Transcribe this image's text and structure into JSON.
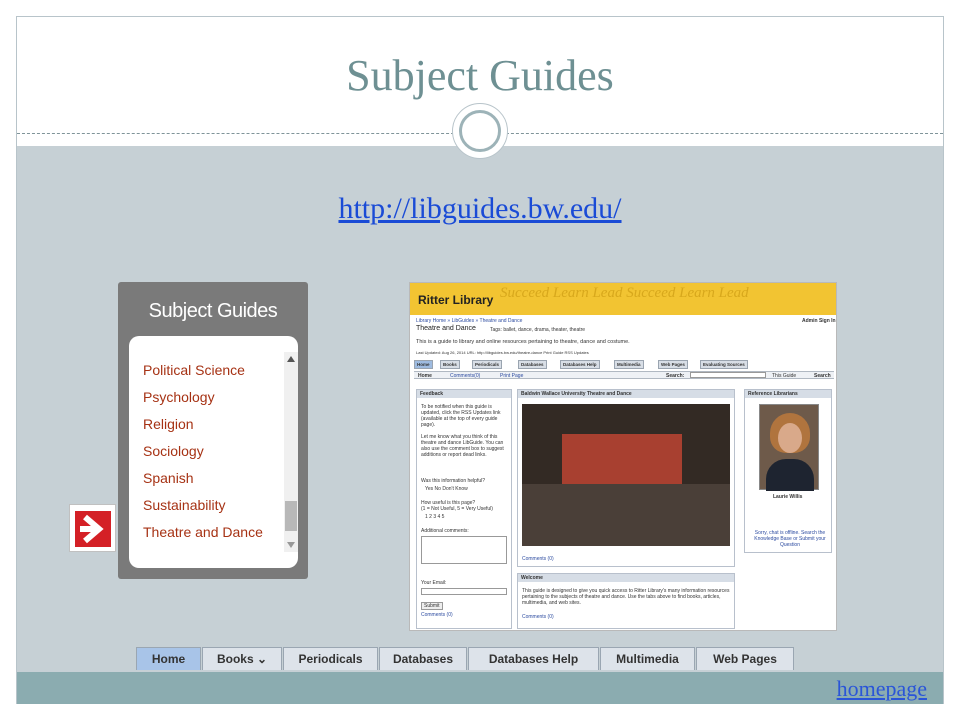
{
  "slide": {
    "title": "Subject Guides",
    "url_link": "http://libguides.bw.edu/",
    "homepage_link": "homepage"
  },
  "subject_widget": {
    "header": "Subject Guides",
    "items": [
      "Political Science",
      "Psychology",
      "Religion",
      "Sociology",
      "Spanish",
      "Sustainability",
      "Theatre and Dance"
    ]
  },
  "libguide_screenshot": {
    "banner_title": "Ritter Library",
    "banner_watermark": "Succeed  Learn  Lead  Succeed  Learn  Lead",
    "breadcrumb": "Library Home  »  LibGuides  »  Theatre and Dance",
    "admin_sign_in": "Admin Sign In",
    "guide_title": "Theatre and Dance",
    "tags": "Tags: ballet, dance, drama, theater, theatre",
    "description": "This is a guide to library and online resources pertaining to theatre, dance and costume.",
    "meta": "Last Updated: Aug 26, 2014   URL: http://libguides.bw.edu/theatre-dance   Print Guide   RSS Updates",
    "tabs": [
      "Home",
      "Books",
      "Periodicals",
      "Databases",
      "Databases Help",
      "Multimedia",
      "Web Pages",
      "Evaluating Sources"
    ],
    "subbar_home": "Home",
    "subbar_comments": "Comments(0)",
    "subbar_print": "Print Page",
    "search_label": "Search:",
    "search_scope": "This Guide",
    "search_button": "Search",
    "feedback": {
      "header": "Feedback",
      "text1": "To be notified when this guide is updated, click the RSS Updates link (available at the top of every guide page).",
      "text2": "Let me know what you think of this theatre and dance LibGuide. You can also use the comment box to suggest additions or report dead links.",
      "helpful_q": "Was this information helpful?",
      "helpful_opts": "Yes   No   Don't Know",
      "useful_q": "How useful is this page?",
      "useful_scale": "(1 = Not Useful, 5 = Very Useful)",
      "useful_opts": "1   2   3   4   5",
      "comments_label": "Additional comments:",
      "email_label": "Your Email:",
      "submit": "Submit",
      "comments_count": "Comments (0)"
    },
    "center": {
      "header": "Baldwin Wallace University Theatre and Dance",
      "comments": "Comments (0)",
      "welcome_header": "Welcome",
      "welcome_text": "This guide is designed to give you quick access to Ritter Library's many information resources pertaining to the subjects of theatre and dance. Use the tabs above to find books, articles, multimedia, and web sites.",
      "welcome_comments": "Comments (0)"
    },
    "right": {
      "header": "Reference Librarians",
      "name": "Laurie Willis",
      "chat_text": "Sorry, chat is offline. Search the Knowledge Base or Submit your Question"
    }
  },
  "nav_tabs": [
    "Home",
    "Books ⌄",
    "Periodicals",
    "Databases",
    "Databases Help",
    "Multimedia",
    "Web Pages"
  ],
  "colors": {
    "title": "#6e9093",
    "link": "#1a4bd6",
    "body_bg": "#c6d0d5",
    "footer_bg": "#8bacb0",
    "subject_item": "#a63214",
    "arrow_red": "#d42026",
    "banner_yellow": "#f2c432"
  }
}
